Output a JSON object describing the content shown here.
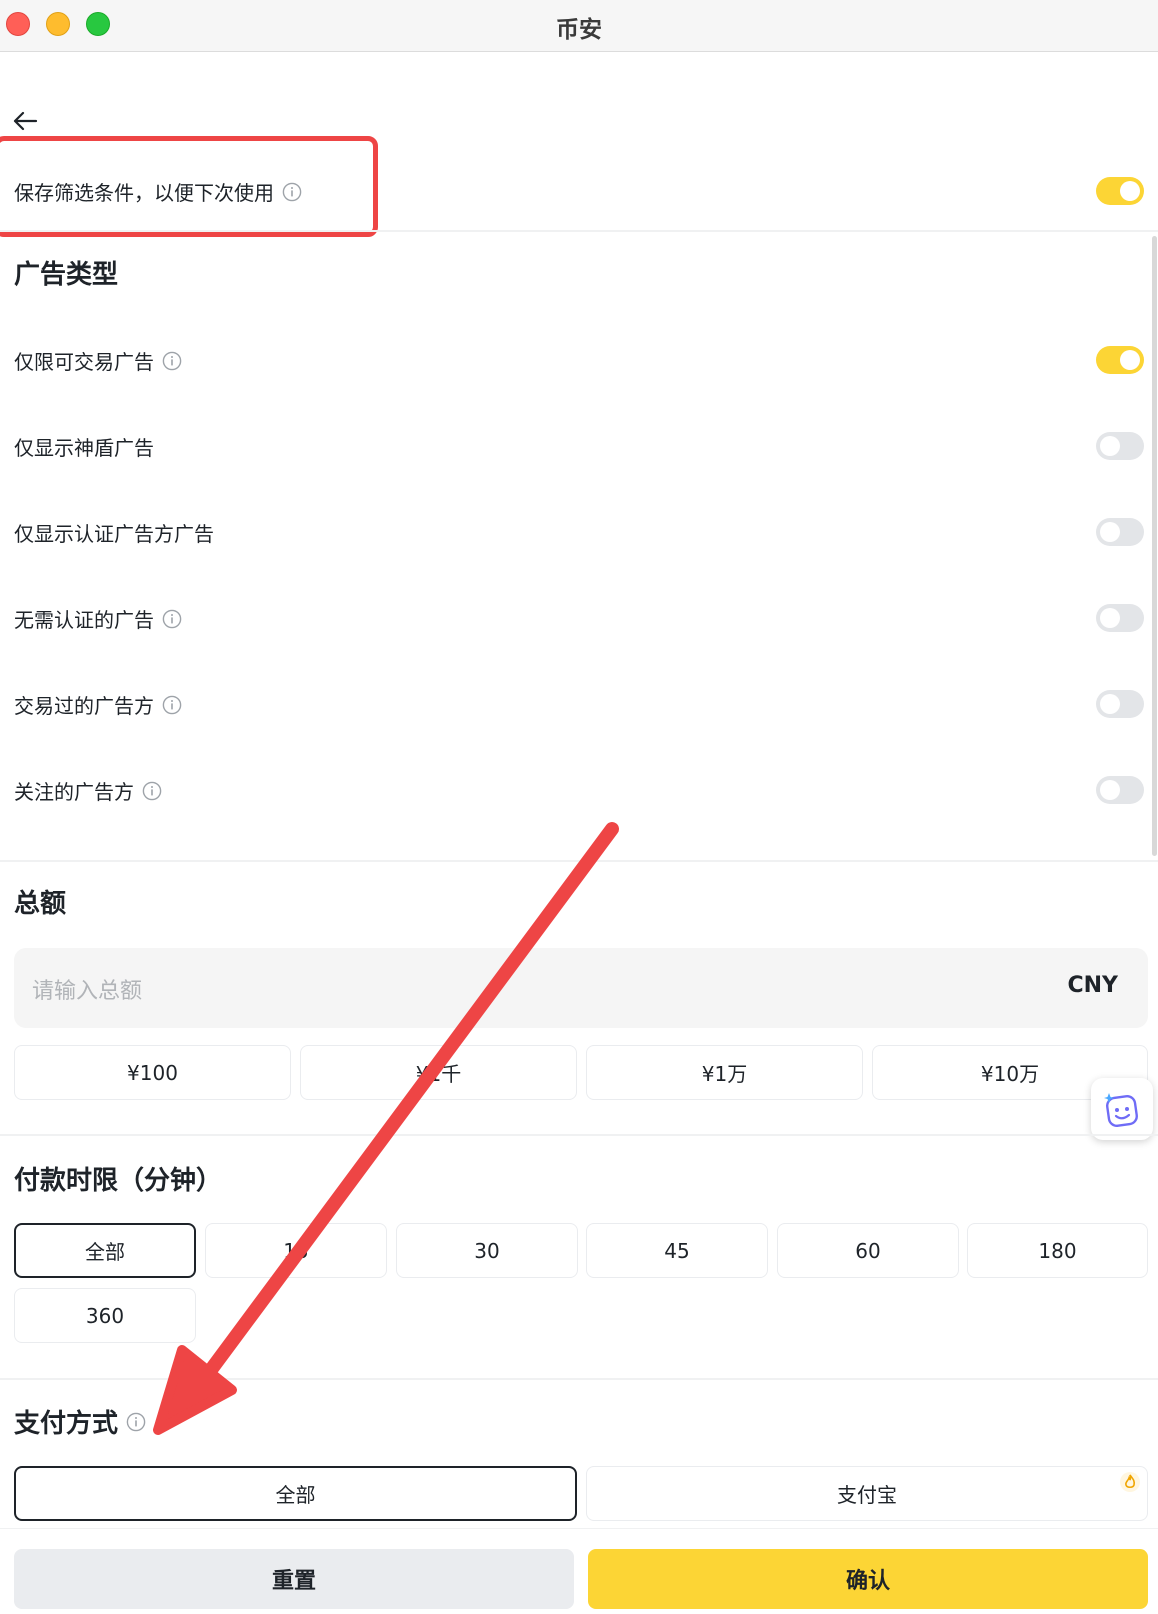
{
  "window": {
    "title": "币安"
  },
  "save_filter": {
    "label": "保存筛选条件，以便下次使用",
    "enabled": true
  },
  "ad_type": {
    "title": "广告类型",
    "items": [
      {
        "label": "仅限可交易广告",
        "info": true,
        "enabled": true
      },
      {
        "label": "仅显示神盾广告",
        "info": false,
        "enabled": false
      },
      {
        "label": "仅显示认证广告方广告",
        "info": false,
        "enabled": false
      },
      {
        "label": "无需认证的广告",
        "info": true,
        "enabled": false
      },
      {
        "label": "交易过的广告方",
        "info": true,
        "enabled": false
      },
      {
        "label": "关注的广告方",
        "info": true,
        "enabled": false
      }
    ]
  },
  "total": {
    "title": "总额",
    "placeholder": "请输入总额",
    "currency": "CNY",
    "presets": [
      "¥100",
      "¥1千",
      "¥1万",
      "¥10万"
    ]
  },
  "payment_time": {
    "title": "付款时限（分钟）",
    "options": [
      "全部",
      "15",
      "30",
      "45",
      "60",
      "180",
      "360"
    ],
    "selected": "全部"
  },
  "payment_method": {
    "title": "支付方式",
    "options": [
      "全部",
      "支付宝"
    ],
    "selected": "全部"
  },
  "actions": {
    "reset": "重置",
    "confirm": "确认"
  },
  "colors": {
    "accent": "#fcd535",
    "annotation": "#ee4545",
    "text": "#1e2329"
  }
}
